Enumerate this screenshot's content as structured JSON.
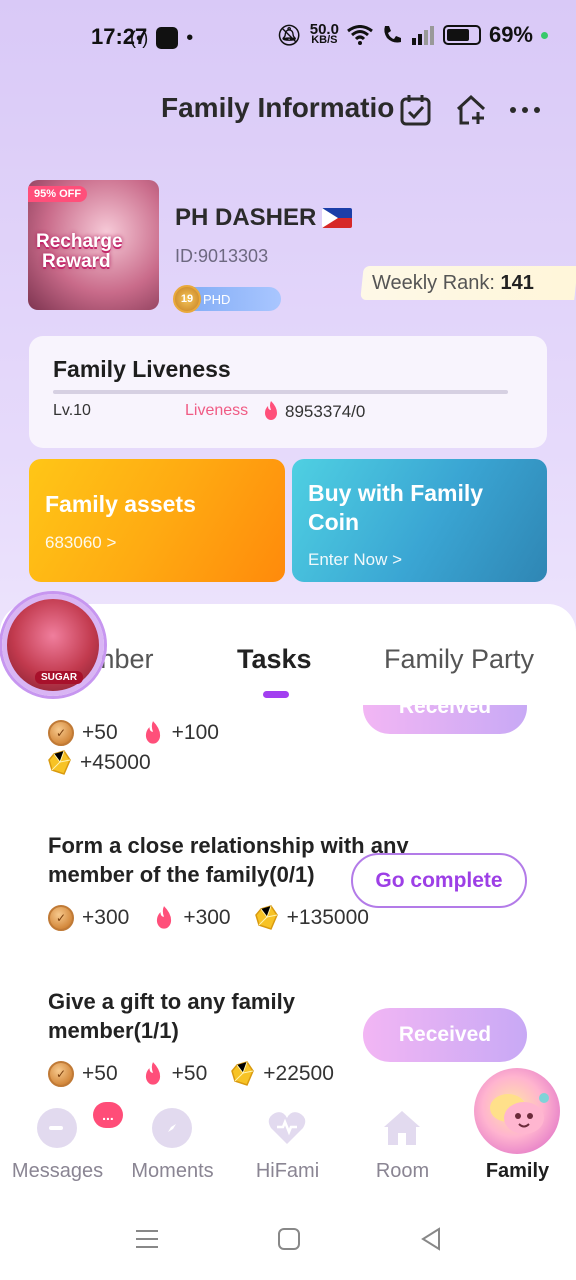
{
  "status_bar": {
    "time": "17:27",
    "net_speed_value": "50.0",
    "net_speed_unit": "KB/S",
    "battery": "69%"
  },
  "header": {
    "title": "Family Informatio"
  },
  "banner": {
    "discount": "95% OFF",
    "line1": "Recharge",
    "line2": "Reward"
  },
  "family": {
    "name": "PH DASHER",
    "id": "ID:9013303",
    "level_badge": "19",
    "level_text": "PHD",
    "weekly_rank_label": "Weekly Rank:",
    "weekly_rank_value": "141"
  },
  "liveness": {
    "title": "Family Liveness",
    "level": "Lv.10",
    "label": "Liveness",
    "value": "8953374/0"
  },
  "cards": {
    "assets_title": "Family assets",
    "assets_value": "683060 >",
    "coin_title": "Buy with Family Coin",
    "coin_sub": "Enter Now >"
  },
  "tabs": [
    "mber",
    "Tasks",
    "Family Party"
  ],
  "avatar_tag": "SUGAR",
  "tasks": [
    {
      "title": "",
      "rewards": [
        "+50",
        "+100",
        "+45000"
      ],
      "button": "Received"
    },
    {
      "title": "Form a close relationship with any member of the family(0/1)",
      "rewards": [
        "+300",
        "+300",
        "+135000"
      ],
      "button": "Go complete"
    },
    {
      "title": "Give a gift to any family member(1/1)",
      "rewards": [
        "+50",
        "+50",
        "+22500"
      ],
      "button": "Received"
    }
  ],
  "bottom_nav": {
    "items": [
      "Messages",
      "Moments",
      "HiFami",
      "Room",
      "Family"
    ],
    "active": "Family",
    "messages_badge": "..."
  },
  "colors": {
    "accent": "#a23ff0",
    "liveness_red": "#f05b84",
    "assets_orange": "#ffab12",
    "coin_blue": "#3aa5d3"
  }
}
